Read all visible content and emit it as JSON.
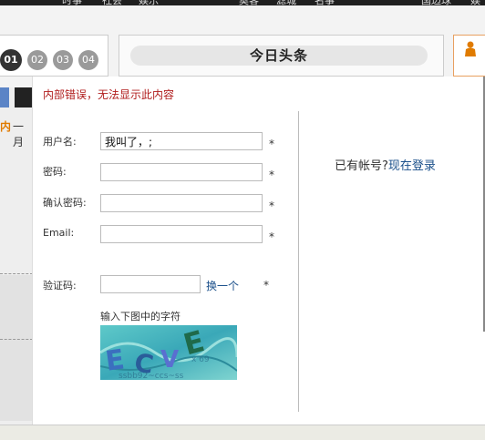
{
  "topnav": {
    "items": [
      "时事",
      "社会",
      "娱乐",
      "奥客",
      "滤城",
      "名事",
      "国边球",
      "娱"
    ]
  },
  "pager": [
    "01",
    "02",
    "03",
    "04"
  ],
  "headline": "今日头条",
  "left_strip": {
    "text_orange": "内",
    "text_dark": "一月"
  },
  "dialog": {
    "error": "内部错误，无法显示此内容",
    "fields": {
      "username_label": "用户名:",
      "username_value": "我叫了，;",
      "password_label": "密码:",
      "confirm_label": "确认密码:",
      "email_label": "Email:",
      "captcha_label": "验证码:",
      "refresh_link": "换一个",
      "required_mark": "*",
      "captcha_hint": "输入下图中的字符"
    },
    "login": {
      "prompt": "已有帐号?",
      "link": "现在登录"
    }
  },
  "colors": {
    "error": "#b01c1c",
    "link": "#1a4f8a",
    "topbar": "#1f1f1f"
  }
}
